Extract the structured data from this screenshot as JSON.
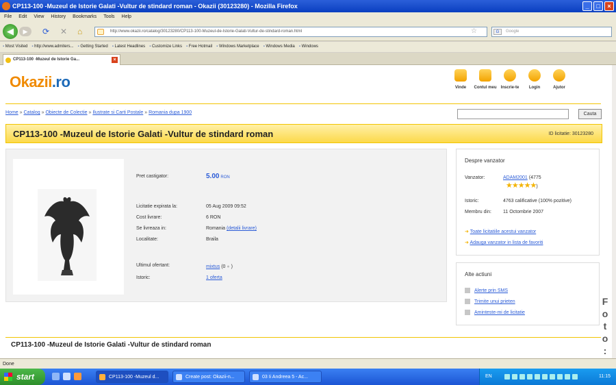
{
  "window": {
    "title": "CP113-100 -Muzeul de Istorie Galati -Vultur de stindard roman - Okazii (30123280) - Mozilla Firefox"
  },
  "menu": [
    "File",
    "Edit",
    "View",
    "History",
    "Bookmarks",
    "Tools",
    "Help"
  ],
  "nav": {
    "url": "http://www.okazii.ro/catalog/30123280/CP113-100-Muzeul-de-Istorie-Galati-Vultur-de-stindard-roman.html",
    "search_placeholder": "Google"
  },
  "bookmarks": [
    "Most Visited",
    "http://www.admiters...",
    "Getting Started",
    "Latest Headlines",
    "Customize Links",
    "Free Hotmail",
    "Windows Marketplace",
    "Windows Media",
    "Windows"
  ],
  "tab": {
    "label": "CP113-100 -Muzeul de Istorie Ga..."
  },
  "site": {
    "logo": "Okazii",
    "logo_tld": ".ro",
    "topnav": [
      "Vinde",
      "Contul meu",
      "Inscrie-te",
      "Login",
      "Ajutor"
    ],
    "breadcrumb": [
      "Home",
      "Catalog",
      "Obiecte de Colectie",
      "Ilustrate si Carti Postale",
      "Romania dupa 1900"
    ],
    "search_button": "Cauta"
  },
  "listing": {
    "title": "CP113-100 -Muzeul de Istorie Galati -Vultur de stindard roman",
    "id_label": "ID licitatie: 30123280",
    "price_label": "Pret castigator:",
    "price_value": "5.00",
    "price_currency": "RON",
    "expired_label": "Licitatie expirata la:",
    "expired_value": "05 Aug 2009 09:52",
    "shipping_label": "Cost livrare:",
    "shipping_value": "6 RON",
    "location_label": "Se livreaza in:",
    "location_value": "Romania",
    "location_link": "(detalii livrare)",
    "city_label": "Localitate:",
    "city_value": "Braila",
    "lastbid_label": "Ultimul ofertant:",
    "lastbid_value": "mixtus",
    "lastbid_extra": "(0",
    "lastbid_close": ")",
    "history_label": "Istoric:",
    "history_value": "1 oferta"
  },
  "seller": {
    "heading": "Despre vanzator",
    "seller_label": "Vanzator:",
    "seller_name": "ADAM2001",
    "seller_score": "(4775",
    "rating_stars": 5,
    "stars_close": ")",
    "history_label": "Istoric:",
    "history_value": "4763 calificative (100% pozitive)",
    "member_label": "Membru din:",
    "member_value": "11 Octombrie 2007",
    "link_all": "Toate licitatiile acestui vanzator",
    "link_fav": "Adauga vanzator in lista de favoriti"
  },
  "actions": {
    "heading": "Alte actiuni",
    "items": [
      "Alerte prin SMS",
      "Trimite unui prieten",
      "Aminteste-mi de licitatie"
    ]
  },
  "bottom_title": "CP113-100 -Muzeul de Istorie Galati -Vultur de stindard roman",
  "watermark": "Foto:",
  "status": "Done",
  "taskbar": {
    "start": "start",
    "buttons": [
      "CP113-100 -Muzeul d...",
      "Create post: Okazii-n...",
      "03 Ii Andreea 5 - Ac..."
    ],
    "lang": "EN",
    "clock": "11:15"
  },
  "colors": {
    "accent_yellow": "#fcd94a",
    "link_blue": "#2a5bd7",
    "logo_orange": "#f08a00"
  }
}
